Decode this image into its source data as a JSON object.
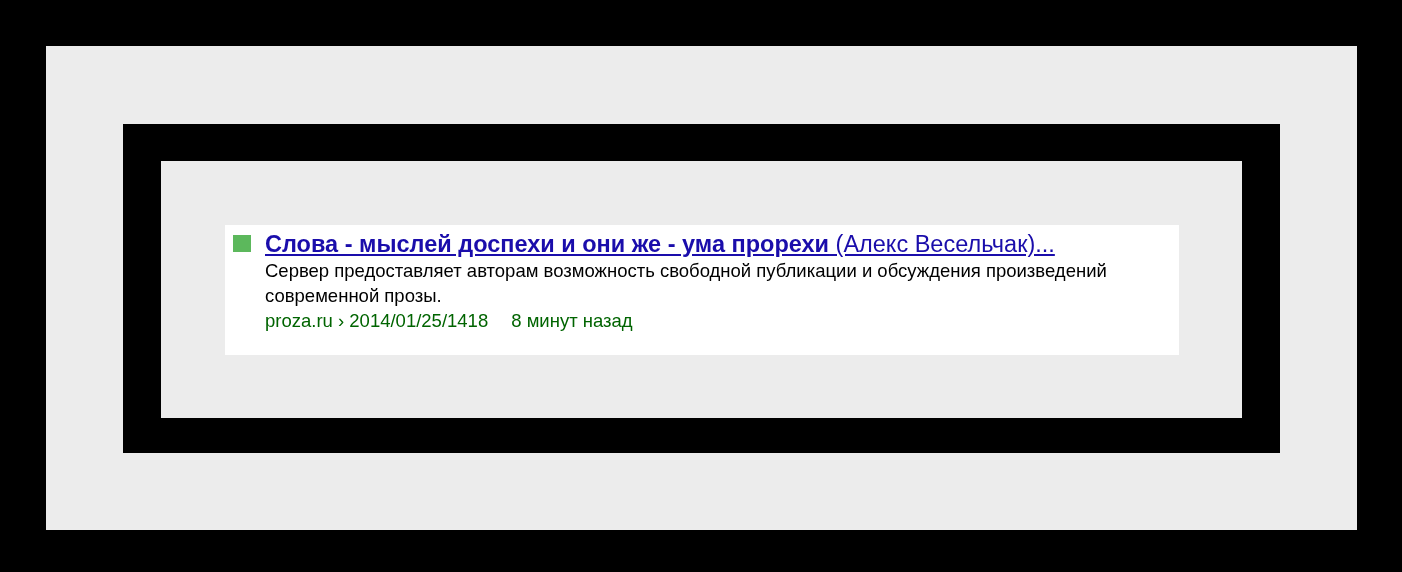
{
  "search_result": {
    "title": "**Слова - мыслей доспехи и они же - ума прорехи** (Алекс Весельчак)...",
    "snippet": "Сервер предоставляет авторам возможность свободной публикации и обсуждения произведений современной прозы.",
    "url": "proza.ru › 2014/01/25/1418",
    "time": "8 минут назад"
  }
}
